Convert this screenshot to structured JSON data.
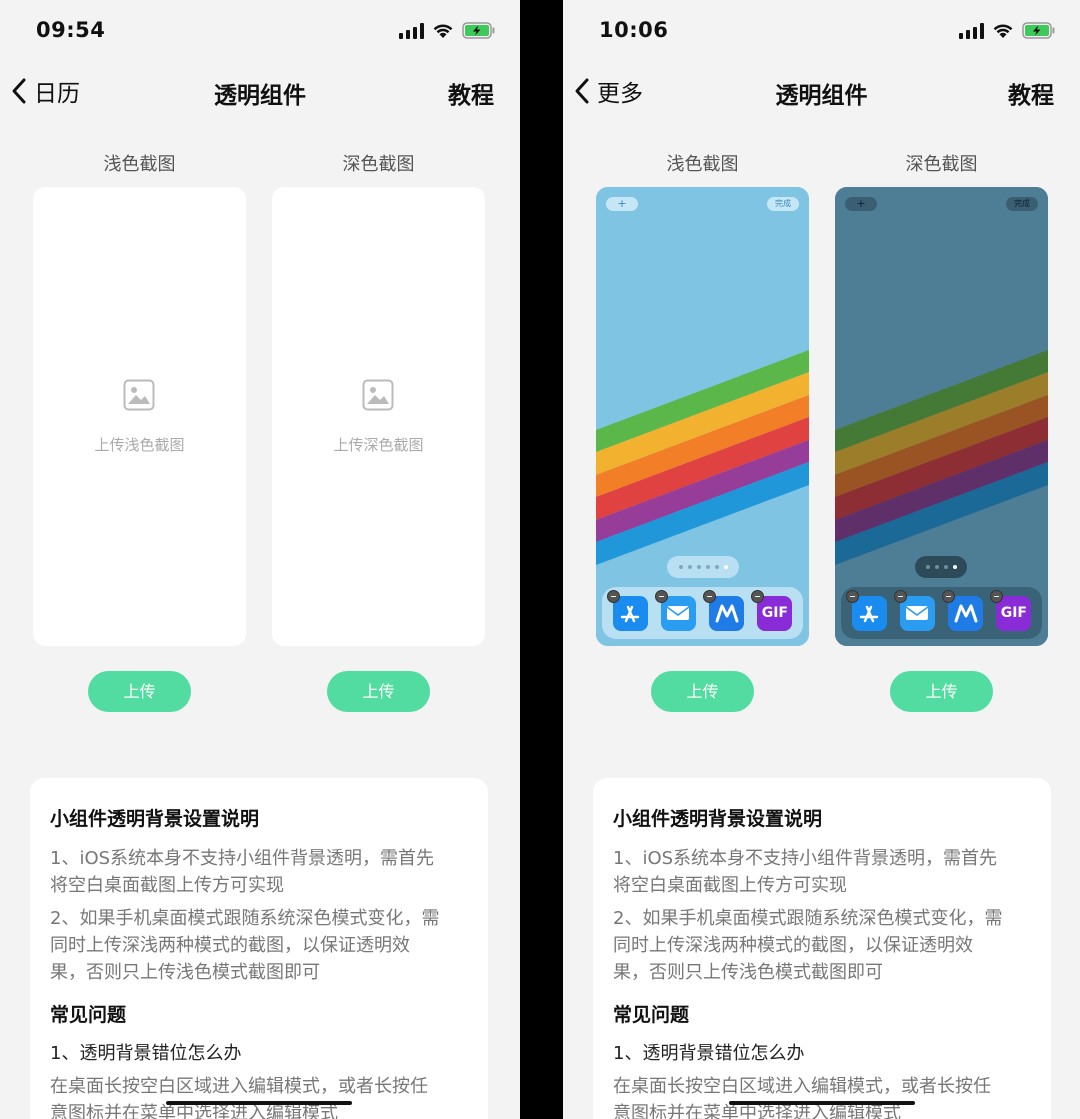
{
  "screens": [
    {
      "status": {
        "time": "09:54"
      },
      "nav": {
        "back": "日历",
        "title": "透明组件",
        "right": "教程"
      },
      "columns": {
        "light_label": "浅色截图",
        "dark_label": "深色截图"
      },
      "light_placeholder": "上传浅色截图",
      "dark_placeholder": "上传深色截图",
      "upload_label": "上传"
    },
    {
      "status": {
        "time": "10:06"
      },
      "nav": {
        "back": "更多",
        "title": "透明组件",
        "right": "教程"
      },
      "columns": {
        "light_label": "浅色截图",
        "dark_label": "深色截图"
      },
      "upload_label": "上传",
      "light_shot": {
        "add": "+",
        "done": "完成",
        "dock_apps": [
          "app-store-icon",
          "mail-icon",
          "maps-icon",
          "GIF"
        ]
      },
      "dark_shot": {
        "add": "+",
        "done": "完成",
        "dock_apps": [
          "app-store-icon",
          "mail-icon",
          "maps-icon",
          "GIF"
        ]
      }
    }
  ],
  "info": {
    "title": "小组件透明背景设置说明",
    "p1_line1": "1、iOS系统本身不支持小组件背景透明，需首先",
    "p1_line2": "将空白桌面截图上传方可实现",
    "p2_line1": "2、如果手机桌面模式跟随系统深色模式变化，需",
    "p2_line2": "同时上传深浅两种模式的截图，以保证透明效",
    "p2_line3": "果，否则只上传浅色模式截图即可",
    "faq_title": "常见问题",
    "q1": "1、透明背景错位怎么办",
    "a1_line1": "在桌面长按空白区域进入编辑模式，或者长按任",
    "a1_line2": "意图标并在菜单中选择进入编辑模式"
  },
  "colors": {
    "accent": "#52dca1",
    "background": "#f3f3f3",
    "card": "#ffffff"
  }
}
